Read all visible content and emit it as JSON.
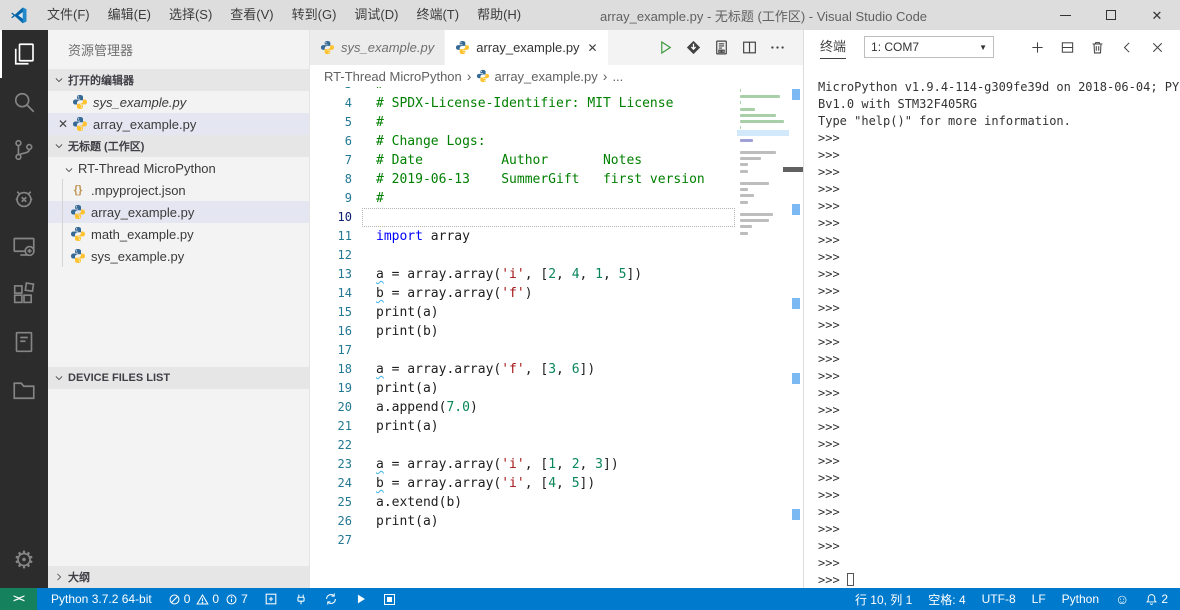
{
  "title_bar": {
    "menus": [
      "文件(F)",
      "编辑(E)",
      "选择(S)",
      "查看(V)",
      "转到(G)",
      "调试(D)",
      "终端(T)",
      "帮助(H)"
    ],
    "title": "array_example.py - 无标题 (工作区) - Visual Studio Code"
  },
  "activity_bar": {
    "items": [
      {
        "name": "explorer",
        "icon": "files-icon",
        "active": true
      },
      {
        "name": "search",
        "icon": "search-icon"
      },
      {
        "name": "source-control",
        "icon": "git-icon"
      },
      {
        "name": "debug",
        "icon": "debug-icon"
      },
      {
        "name": "device-controller",
        "icon": "device-icon"
      },
      {
        "name": "extensions",
        "icon": "extensions-icon"
      },
      {
        "name": "notebook",
        "icon": "notebook-icon"
      },
      {
        "name": "folder-view",
        "icon": "folder-icon"
      }
    ],
    "gear_icon": "⚙"
  },
  "sidebar": {
    "title": "资源管理器",
    "open_editors": {
      "header": "打开的编辑器",
      "items": [
        {
          "label": "sys_example.py",
          "preview": true,
          "selected": false,
          "show_close": false
        },
        {
          "label": "array_example.py",
          "preview": false,
          "selected": true,
          "show_close": true
        }
      ]
    },
    "workspace": {
      "header": "无标题 (工作区)",
      "folder": "RT-Thread MicroPython",
      "files": [
        {
          "label": ".mpyproject.json",
          "icon": "json",
          "selected": false
        },
        {
          "label": "array_example.py",
          "icon": "python",
          "selected": true
        },
        {
          "label": "math_example.py",
          "icon": "python",
          "selected": false
        },
        {
          "label": "sys_example.py",
          "icon": "python",
          "selected": false
        }
      ]
    },
    "device_files_header": "DEVICE FILES LIST",
    "outline_header": "大纲"
  },
  "editor": {
    "tabs": [
      {
        "label": "sys_example.py",
        "active": false,
        "preview": true,
        "show_close": false
      },
      {
        "label": "array_example.py",
        "active": true,
        "preview": false,
        "show_close": true
      }
    ],
    "actions": [
      {
        "name": "run-file",
        "icon": "run-icon"
      },
      {
        "name": "download-to-device",
        "icon": "download-icon"
      },
      {
        "name": "run-on-device",
        "icon": "chip-icon"
      },
      {
        "name": "split-editor",
        "icon": "split-editor-icon"
      },
      {
        "name": "more-actions",
        "icon": "more-icon"
      }
    ],
    "breadcrumb": {
      "root": "RT-Thread MicroPython",
      "file": "array_example.py",
      "tail": "...",
      "separator": "›"
    },
    "code": {
      "lines": [
        {
          "n": 3,
          "parts": [
            {
              "t": "#",
              "c": "cm"
            }
          ]
        },
        {
          "n": 4,
          "parts": [
            {
              "t": "# SPDX-License-Identifier: MIT License",
              "c": "cm"
            }
          ]
        },
        {
          "n": 5,
          "parts": [
            {
              "t": "#",
              "c": "cm"
            }
          ]
        },
        {
          "n": 6,
          "parts": [
            {
              "t": "# Change Logs:",
              "c": "cm"
            }
          ]
        },
        {
          "n": 7,
          "parts": [
            {
              "t": "# Date          Author       Notes",
              "c": "cm"
            }
          ]
        },
        {
          "n": 8,
          "parts": [
            {
              "t": "# 2019-06-13    SummerGift   first version",
              "c": "cm"
            }
          ]
        },
        {
          "n": 9,
          "parts": [
            {
              "t": "#",
              "c": "cm"
            }
          ]
        },
        {
          "n": 10,
          "cur": true,
          "parts": []
        },
        {
          "n": 11,
          "parts": [
            {
              "t": "import",
              "c": "kw"
            },
            {
              "t": " array",
              "c": "pl"
            }
          ]
        },
        {
          "n": 12,
          "parts": []
        },
        {
          "n": 13,
          "parts": [
            {
              "t": "a",
              "c": "pl sq"
            },
            {
              "t": " = array.array(",
              "c": "pl"
            },
            {
              "t": "'i'",
              "c": "st"
            },
            {
              "t": ", [",
              "c": "pl"
            },
            {
              "t": "2",
              "c": "nu"
            },
            {
              "t": ", ",
              "c": "pl"
            },
            {
              "t": "4",
              "c": "nu"
            },
            {
              "t": ", ",
              "c": "pl"
            },
            {
              "t": "1",
              "c": "nu"
            },
            {
              "t": ", ",
              "c": "pl"
            },
            {
              "t": "5",
              "c": "nu"
            },
            {
              "t": "])",
              "c": "pl"
            }
          ]
        },
        {
          "n": 14,
          "parts": [
            {
              "t": "b",
              "c": "pl sq"
            },
            {
              "t": " = array.array(",
              "c": "pl"
            },
            {
              "t": "'f'",
              "c": "st"
            },
            {
              "t": ")",
              "c": "pl"
            }
          ]
        },
        {
          "n": 15,
          "parts": [
            {
              "t": "print(a)",
              "c": "pl"
            }
          ]
        },
        {
          "n": 16,
          "parts": [
            {
              "t": "print(b)",
              "c": "pl"
            }
          ]
        },
        {
          "n": 17,
          "parts": []
        },
        {
          "n": 18,
          "parts": [
            {
              "t": "a",
              "c": "pl sq"
            },
            {
              "t": " = array.array(",
              "c": "pl"
            },
            {
              "t": "'f'",
              "c": "st"
            },
            {
              "t": ", [",
              "c": "pl"
            },
            {
              "t": "3",
              "c": "nu"
            },
            {
              "t": ", ",
              "c": "pl"
            },
            {
              "t": "6",
              "c": "nu"
            },
            {
              "t": "])",
              "c": "pl"
            }
          ]
        },
        {
          "n": 19,
          "parts": [
            {
              "t": "print(a)",
              "c": "pl"
            }
          ]
        },
        {
          "n": 20,
          "parts": [
            {
              "t": "a.append(",
              "c": "pl"
            },
            {
              "t": "7.0",
              "c": "nu"
            },
            {
              "t": ")",
              "c": "pl"
            }
          ]
        },
        {
          "n": 21,
          "parts": [
            {
              "t": "print(a)",
              "c": "pl"
            }
          ]
        },
        {
          "n": 22,
          "parts": []
        },
        {
          "n": 23,
          "parts": [
            {
              "t": "a",
              "c": "pl sq"
            },
            {
              "t": " = array.array(",
              "c": "pl"
            },
            {
              "t": "'i'",
              "c": "st"
            },
            {
              "t": ", [",
              "c": "pl"
            },
            {
              "t": "1",
              "c": "nu"
            },
            {
              "t": ", ",
              "c": "pl"
            },
            {
              "t": "2",
              "c": "nu"
            },
            {
              "t": ", ",
              "c": "pl"
            },
            {
              "t": "3",
              "c": "nu"
            },
            {
              "t": "])",
              "c": "pl"
            }
          ]
        },
        {
          "n": 24,
          "parts": [
            {
              "t": "b",
              "c": "pl sq"
            },
            {
              "t": " = array.array(",
              "c": "pl"
            },
            {
              "t": "'i'",
              "c": "st"
            },
            {
              "t": ", [",
              "c": "pl"
            },
            {
              "t": "4",
              "c": "nu"
            },
            {
              "t": ", ",
              "c": "pl"
            },
            {
              "t": "5",
              "c": "nu"
            },
            {
              "t": "])",
              "c": "pl"
            }
          ]
        },
        {
          "n": 25,
          "parts": [
            {
              "t": "a.extend(b)",
              "c": "pl"
            }
          ]
        },
        {
          "n": 26,
          "parts": [
            {
              "t": "print(a)",
              "c": "pl"
            }
          ]
        },
        {
          "n": 27,
          "parts": []
        }
      ]
    }
  },
  "terminal": {
    "tab_label": "终端",
    "selector_value": "1: COM7",
    "actions": [
      {
        "name": "new-terminal",
        "icon": "plus-icon"
      },
      {
        "name": "split-terminal",
        "icon": "split-terminal-icon"
      },
      {
        "name": "kill-terminal",
        "icon": "trash-icon"
      },
      {
        "name": "collapse-panel",
        "icon": "chevron-left-icon"
      },
      {
        "name": "close-panel",
        "icon": "close-icon"
      }
    ],
    "banner": [
      "MicroPython v1.9.4-114-g309fe39d on 2018-06-04; PY",
      "Bv1.0 with STM32F405RG",
      "Type \"help()\" for more information."
    ],
    "prompt": ">>>",
    "prompt_count": 27
  },
  "status_bar": {
    "remote_glyph": "><",
    "python_version": "Python 3.7.2 64-bit",
    "errors": "0",
    "warnings": "0",
    "infos": "7",
    "line_col": "行 10, 列 1",
    "indent": "空格: 4",
    "encoding": "UTF-8",
    "eol": "LF",
    "language": "Python",
    "smiley": "☺",
    "bell_count": "2"
  },
  "colors": {
    "status_bar": "#007acc",
    "remote_badge": "#16825d",
    "activity_bar": "#2c2c2c",
    "selection_row": "#e4e6f1",
    "comment": "#008000",
    "keyword": "#0000ff",
    "string": "#a31515",
    "number": "#098658",
    "run_button": "#3c9a3c"
  }
}
